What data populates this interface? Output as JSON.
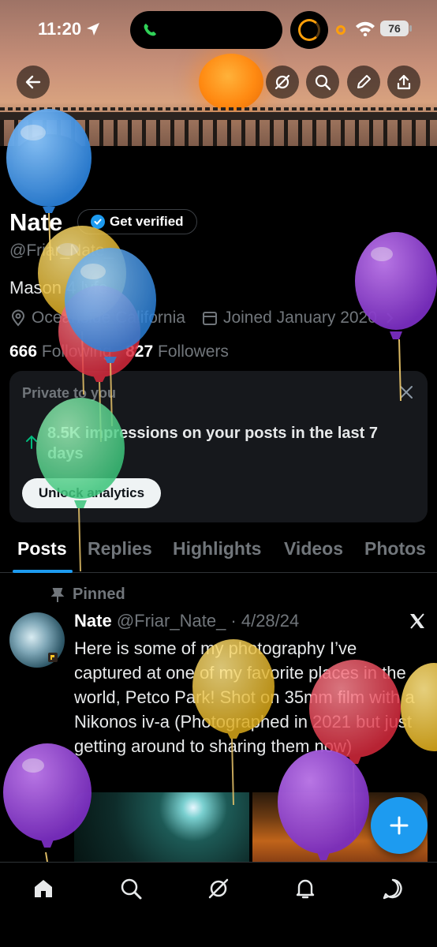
{
  "status_bar": {
    "time": "11:20",
    "battery": "76"
  },
  "profile": {
    "name": "Nate",
    "verify_label": "Get verified",
    "handle": "@Friar_Nate_",
    "bio": "Mason 4 lyfe",
    "location": "Oceanside California",
    "joined": "Joined January 2020",
    "following_count": "666",
    "following_label": "Following",
    "followers_count": "827",
    "followers_label": "Followers"
  },
  "private_card": {
    "label": "Private to you",
    "text": "8.5K impressions on your posts in the last 7 days",
    "button": "Unlock analytics"
  },
  "tabs": [
    "Posts",
    "Replies",
    "Highlights",
    "Videos",
    "Photos"
  ],
  "post": {
    "pinned_label": "Pinned",
    "author": "Nate",
    "handle_date": "@Friar_Nate_ · 4/28/24",
    "text": "Here is some of my photography I’ve captured at one of my favorite places in the world, Petco Park! Shot on 35mm film with a Nikonos iv-a (Photographed in 2021 but just getting around to sharing them now)"
  },
  "icons": {
    "back": "back-arrow-icon",
    "grok": "grok-icon",
    "search": "search-icon",
    "edit": "pencil-icon",
    "share": "share-icon",
    "compose": "plus-icon",
    "nav": [
      "home-icon",
      "search-icon",
      "grok-icon",
      "bell-icon",
      "messages-icon"
    ]
  },
  "colors": {
    "accent": "#1d9bf0",
    "background": "#000000",
    "muted_text": "#71767b"
  }
}
